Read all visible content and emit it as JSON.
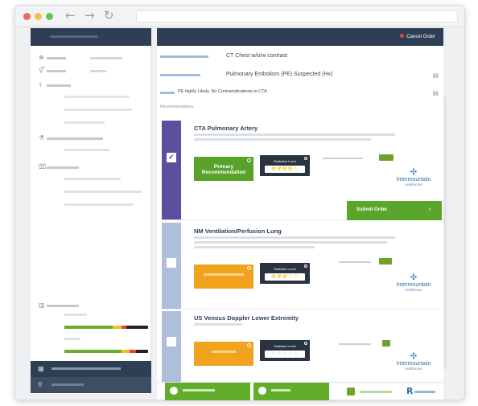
{
  "browser": {
    "dots": [
      "#ec6a5e",
      "#f4bf4f",
      "#61c554"
    ],
    "back_icon": "arrow-left-icon",
    "forward_icon": "arrow-right-icon",
    "reload_icon": "reload-icon"
  },
  "header": {
    "cancel_order": "Cancel Order"
  },
  "order": {
    "procedure_value": "CT Chest w/o/w contrast",
    "indication_value": "Pulmonary Embolism (PE) Suspected (Hx)",
    "sub_indication_value": "PE highly Likely. No Contraindications to CTA",
    "recommendations_label": "Recommendations"
  },
  "cards": [
    {
      "title": "CTA Pulmonary Artery",
      "recommendation": "Primary Recommendation",
      "radiation_label": "Radiation Level",
      "stars": "☢☢☢☢☆",
      "strip_color": "#5d4fa0",
      "rec_color": "#57a22b",
      "checked": "✔",
      "submit_label": "Submit Order"
    },
    {
      "title": "NM Ventilation/Perfusion Lung",
      "radiation_label": "Radiation Level",
      "stars": "☢☢☢☆☆",
      "strip_color": "#aebedb",
      "rec_color": "#f2a31e"
    },
    {
      "title": "US Venous Doppler Lower Extremity",
      "radiation_label": "Radiation Level",
      "stars": "☆☆☆☆☆",
      "strip_color": "#aebedb",
      "rec_color": "#f2a31e"
    }
  ],
  "logo": {
    "name": "Intermountain",
    "sub": "Healthcare"
  },
  "footer": {
    "brand_mark": "R"
  },
  "colors": {
    "navy": "#2e3f55",
    "green": "#5aa52b",
    "orange": "#f2a31e",
    "purple": "#5d4fa0"
  }
}
